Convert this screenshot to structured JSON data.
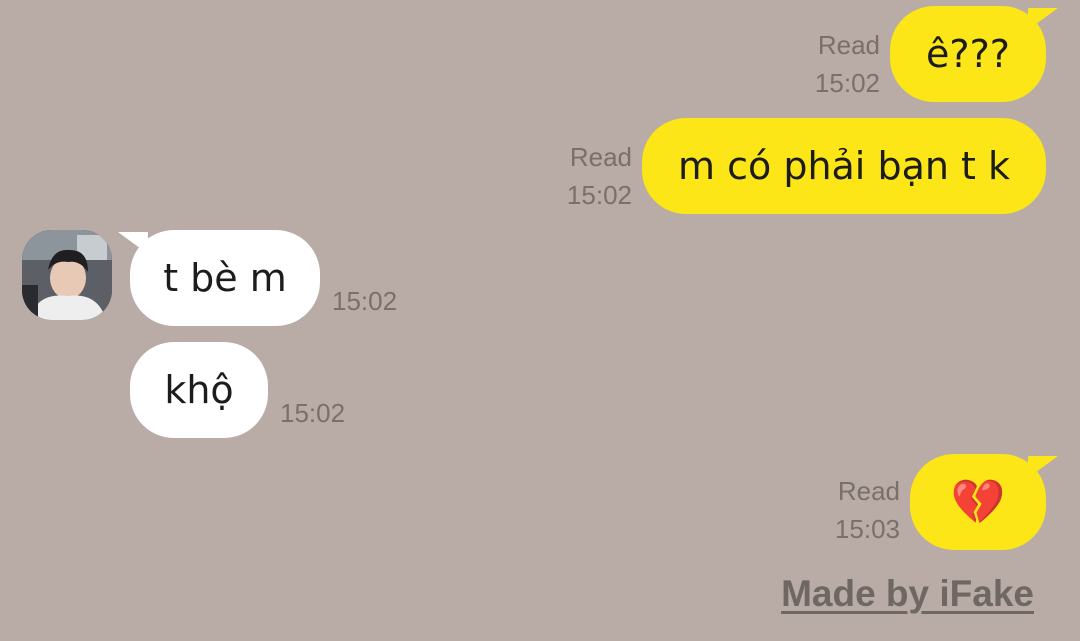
{
  "chat": {
    "messages": [
      {
        "direction": "outgoing",
        "text": "ê???",
        "status": "Read",
        "time": "15:02"
      },
      {
        "direction": "outgoing",
        "text": "m có phải bạn t k",
        "status": "Read",
        "time": "15:02"
      },
      {
        "direction": "incoming",
        "text": "t bè m",
        "time": "15:02"
      },
      {
        "direction": "incoming",
        "text": "khộ",
        "time": "15:02"
      },
      {
        "direction": "outgoing",
        "text": "💔",
        "status": "Read",
        "time": "15:03"
      }
    ],
    "contact": {
      "avatar": "contact-avatar-photo"
    }
  },
  "watermark": {
    "text": "Made by iFake"
  },
  "colors": {
    "background": "#b9aba5",
    "outgoing_bubble": "#fde617",
    "incoming_bubble": "#ffffff",
    "meta_text": "#7a706b"
  }
}
